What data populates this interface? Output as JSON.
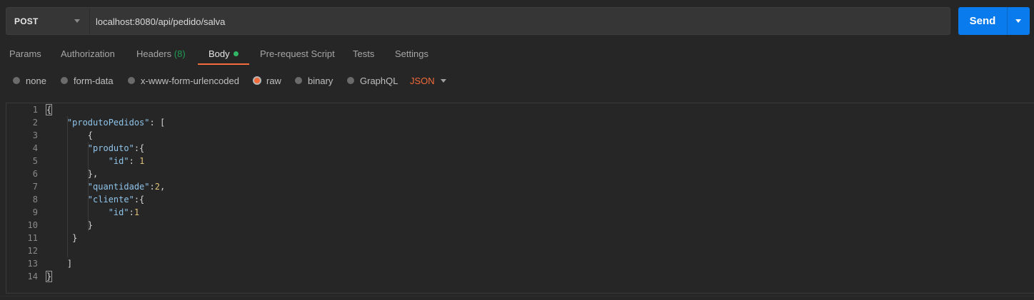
{
  "request": {
    "method": "POST",
    "url": "localhost:8080/api/pedido/salva",
    "send_label": "Send"
  },
  "tabs": [
    {
      "label": "Params"
    },
    {
      "label": "Authorization"
    },
    {
      "label": "Headers",
      "count": "(8)"
    },
    {
      "label": "Body",
      "active": true,
      "has_dot": true
    },
    {
      "label": "Pre-request Script"
    },
    {
      "label": "Tests"
    },
    {
      "label": "Settings"
    }
  ],
  "body_types": [
    {
      "label": "none",
      "checked": false
    },
    {
      "label": "form-data",
      "checked": false
    },
    {
      "label": "x-www-form-urlencoded",
      "checked": false
    },
    {
      "label": "raw",
      "checked": true
    },
    {
      "label": "binary",
      "checked": false
    },
    {
      "label": "GraphQL",
      "checked": false
    }
  ],
  "raw_format": "JSON",
  "editor": {
    "line_numbers": [
      "1",
      "2",
      "3",
      "4",
      "5",
      "6",
      "7",
      "8",
      "9",
      "10",
      "11",
      "12",
      "13",
      "14"
    ],
    "lines": [
      [
        {
          "t": "{",
          "c": "p",
          "hl": true
        }
      ],
      [
        {
          "t": "    "
        },
        {
          "t": "\"produtoPedidos\"",
          "c": "k"
        },
        {
          "t": ": ["
        }
      ],
      [
        {
          "t": "        {"
        }
      ],
      [
        {
          "t": "        "
        },
        {
          "t": "\"produto\"",
          "c": "k"
        },
        {
          "t": ":{"
        }
      ],
      [
        {
          "t": "            "
        },
        {
          "t": "\"id\"",
          "c": "k"
        },
        {
          "t": ": "
        },
        {
          "t": "1",
          "c": "n"
        }
      ],
      [
        {
          "t": "        },"
        }
      ],
      [
        {
          "t": "        "
        },
        {
          "t": "\"quantidade\"",
          "c": "k"
        },
        {
          "t": ":"
        },
        {
          "t": "2",
          "c": "n"
        },
        {
          "t": ","
        }
      ],
      [
        {
          "t": "        "
        },
        {
          "t": "\"cliente\"",
          "c": "k"
        },
        {
          "t": ":{"
        }
      ],
      [
        {
          "t": "            "
        },
        {
          "t": "\"id\"",
          "c": "k"
        },
        {
          "t": ":"
        },
        {
          "t": "1",
          "c": "n"
        }
      ],
      [
        {
          "t": "        }"
        }
      ],
      [
        {
          "t": "     }"
        }
      ],
      [
        {
          "t": ""
        }
      ],
      [
        {
          "t": "    ]"
        }
      ],
      [
        {
          "t": "}",
          "c": "p",
          "hl": true
        }
      ]
    ]
  },
  "colors": {
    "accent": "#f26b3a",
    "send": "#097bed",
    "key": "#8fc4ea",
    "number": "#e0c27a",
    "status_dot": "#32b565"
  }
}
